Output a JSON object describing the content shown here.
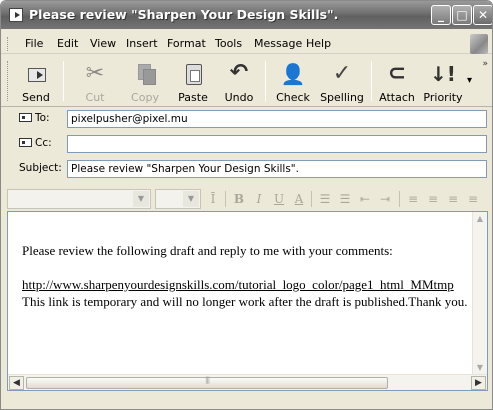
{
  "window": {
    "title": "Please review \"Sharpen Your Design Skills\"."
  },
  "menu": [
    "File",
    "Edit",
    "View",
    "Insert",
    "Format",
    "Tools",
    "Message",
    "Help"
  ],
  "toolbar": {
    "send": "Send",
    "cut": "Cut",
    "copy": "Copy",
    "paste": "Paste",
    "undo": "Undo",
    "check": "Check",
    "spelling": "Spelling",
    "attach": "Attach",
    "priority": "Priority"
  },
  "fields": {
    "to_label": "To:",
    "to_value": "pixelpusher@pixel.mu",
    "cc_label": "Cc:",
    "cc_value": "",
    "subject_label": "Subject:",
    "subject_value": "Please review \"Sharpen Your Design Skills\"."
  },
  "message": {
    "line1": "Please review the following draft and reply to me with your comments:",
    "link": "http://www.sharpenyourdesignskills.com/tutorial_logo_color/page1_html_MMtmp",
    "line2": "This link is temporary and will no longer work after the draft is published.Thank you."
  }
}
